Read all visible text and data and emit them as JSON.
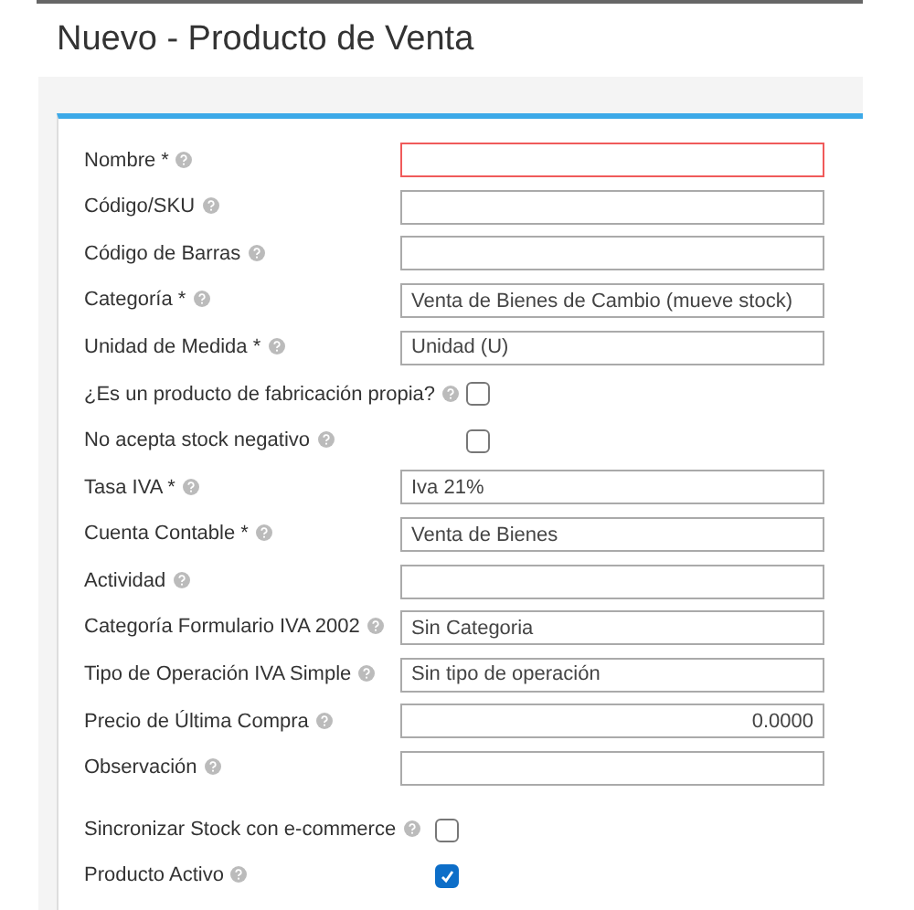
{
  "title": "Nuevo - Producto de Venta",
  "fields": [
    {
      "kind": "text",
      "label": "Nombre *",
      "invalid": true
    },
    {
      "kind": "text",
      "label": "Código/SKU",
      "invalid": false
    },
    {
      "kind": "text",
      "label": "Código de Barras",
      "invalid": false
    },
    {
      "kind": "text",
      "label": "Categoría *",
      "value": "Venta de Bienes de Cambio (mueve stock)",
      "invalid": false
    },
    {
      "kind": "text",
      "label": "Unidad de Medida *",
      "value": "Unidad (U)",
      "invalid": false
    },
    {
      "kind": "checkbox",
      "label": "¿Es un producto de fabricación propia?",
      "checked": false
    },
    {
      "kind": "checkbox",
      "label": "No acepta stock negativo",
      "checked": false
    },
    {
      "kind": "text",
      "label": "Tasa IVA *",
      "value": "Iva 21%",
      "invalid": false
    },
    {
      "kind": "text",
      "label": "Cuenta Contable *",
      "value": "Venta de Bienes",
      "invalid": false
    },
    {
      "kind": "text",
      "label": "Actividad",
      "invalid": false
    },
    {
      "kind": "text",
      "label": "Categoría Formulario IVA 2002",
      "value": "Sin Categoria",
      "invalid": false
    },
    {
      "kind": "text",
      "label": "Tipo de Operación IVA Simple",
      "value": "Sin tipo de operación",
      "invalid": false
    },
    {
      "kind": "number",
      "label": "Precio de Última Compra",
      "value": "0.0000",
      "invalid": false
    },
    {
      "kind": "text",
      "label": "Observación",
      "invalid": false
    }
  ],
  "footer_checks": [
    {
      "label": "Sincronizar Stock con e-commerce",
      "checked": false
    },
    {
      "label": "Producto Activo",
      "checked": true
    }
  ]
}
